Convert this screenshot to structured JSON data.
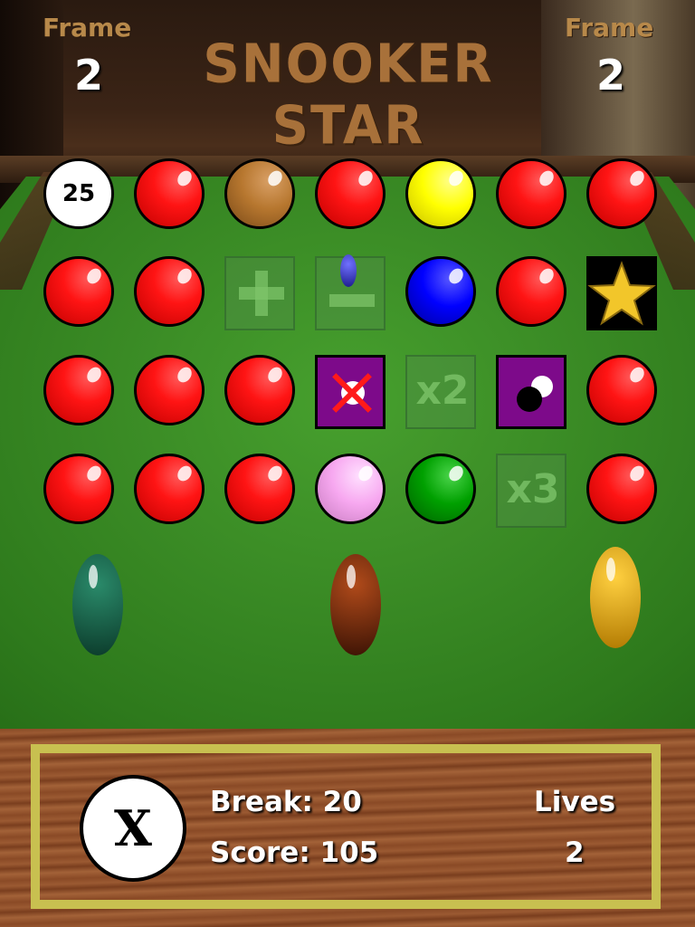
{
  "header": {
    "title": "SNOOKER STAR",
    "frame_left_label": "Frame",
    "frame_left_value": "2",
    "frame_right_label": "Frame",
    "frame_right_value": "2"
  },
  "grid": {
    "rows": [
      [
        "white-25",
        "red",
        "brown",
        "red",
        "yellow",
        "red",
        "red"
      ],
      [
        "red",
        "red",
        "plus-tile",
        "minus-tile",
        "blue",
        "red",
        "star-tile"
      ],
      [
        "red",
        "red",
        "red",
        "cue-ball-cross-tile",
        "x2-tile",
        "black-white-tile",
        "red"
      ],
      [
        "red",
        "red",
        "red",
        "pink",
        "green",
        "x3-tile",
        "red"
      ]
    ],
    "white_ball_value": "25",
    "x2_label": "x2",
    "x3_label": "x3"
  },
  "panel": {
    "exit_button_label": "X",
    "break_text": "Break: 20",
    "score_text": "Score: 105",
    "lives_label": "Lives",
    "lives_value": "2"
  },
  "colors": {
    "red": "#ff1414",
    "brown": "#b7772f",
    "yellow": "#ffff00",
    "blue": "#0000ff",
    "pink": "#f7a8f0",
    "green": "#00a000",
    "tile_purple": "#7d0a8a",
    "title_brown": "#a8713a",
    "panel_border": "#c8c050"
  }
}
